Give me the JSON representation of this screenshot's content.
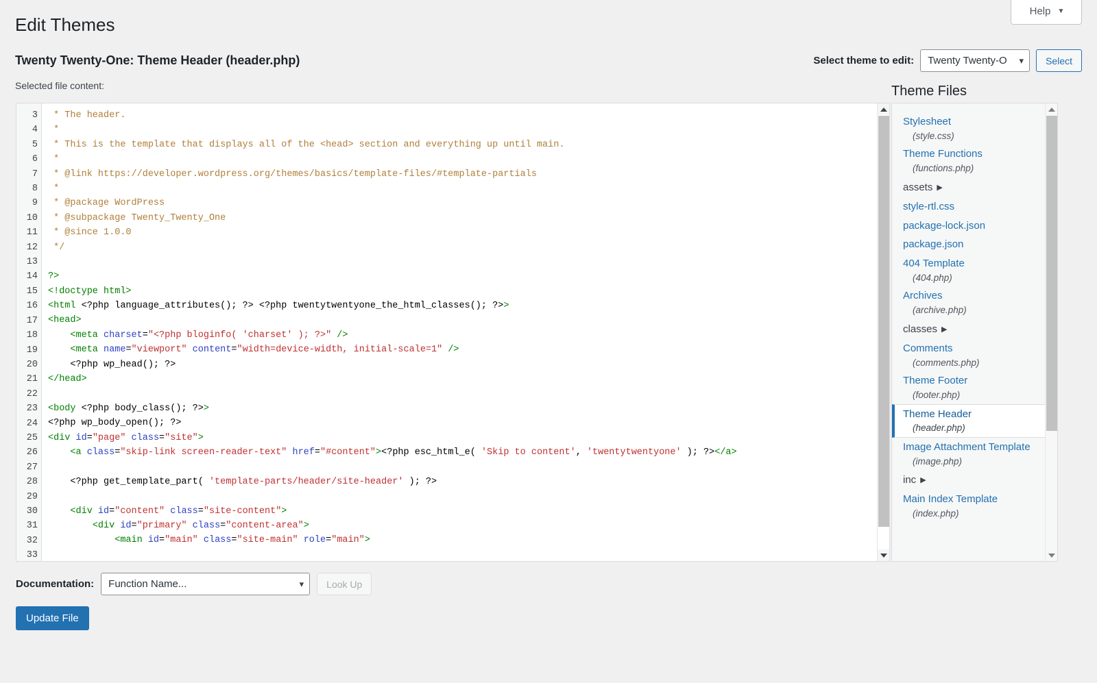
{
  "header": {
    "help_label": "Help",
    "help_caret": "▼",
    "page_title": "Edit Themes",
    "file_heading": "Twenty Twenty-One: Theme Header (header.php)",
    "selected_file_label": "Selected file content:",
    "theme_select_label": "Select theme to edit:",
    "theme_select_value": "Twenty Twenty-O",
    "theme_select_caret": "⌄",
    "select_button": "Select"
  },
  "editor": {
    "first_line_number": 3,
    "lines": [
      {
        "n": 3,
        "tokens": [
          {
            "t": "comment",
            "v": " * The header."
          }
        ]
      },
      {
        "n": 4,
        "tokens": [
          {
            "t": "comment",
            "v": " *"
          }
        ]
      },
      {
        "n": 5,
        "tokens": [
          {
            "t": "comment",
            "v": " * This is the template that displays all of the <head> section and everything up until main."
          }
        ]
      },
      {
        "n": 6,
        "tokens": [
          {
            "t": "comment",
            "v": " *"
          }
        ]
      },
      {
        "n": 7,
        "tokens": [
          {
            "t": "comment",
            "v": " * @link https://developer.wordpress.org/themes/basics/template-files/#template-partials"
          }
        ]
      },
      {
        "n": 8,
        "tokens": [
          {
            "t": "comment",
            "v": " *"
          }
        ]
      },
      {
        "n": 9,
        "tokens": [
          {
            "t": "comment",
            "v": " * @package WordPress"
          }
        ]
      },
      {
        "n": 10,
        "tokens": [
          {
            "t": "comment",
            "v": " * @subpackage Twenty_Twenty_One"
          }
        ]
      },
      {
        "n": 11,
        "tokens": [
          {
            "t": "comment",
            "v": " * @since 1.0.0"
          }
        ]
      },
      {
        "n": 12,
        "tokens": [
          {
            "t": "comment",
            "v": " */"
          }
        ]
      },
      {
        "n": 13,
        "tokens": [
          {
            "t": "plain",
            "v": ""
          }
        ]
      },
      {
        "n": 14,
        "tokens": [
          {
            "t": "tag",
            "v": "?>"
          }
        ]
      },
      {
        "n": 15,
        "tokens": [
          {
            "t": "tag",
            "v": "<!doctype html>"
          }
        ]
      },
      {
        "n": 16,
        "tokens": [
          {
            "t": "tag",
            "v": "<html"
          },
          {
            "t": "plain",
            "v": " <?php language_attributes(); ?> <?php twentytwentyone_the_html_classes(); ?>"
          },
          {
            "t": "tag",
            "v": ">"
          }
        ]
      },
      {
        "n": 17,
        "tokens": [
          {
            "t": "tag",
            "v": "<head>"
          }
        ]
      },
      {
        "n": 18,
        "tokens": [
          {
            "t": "plain",
            "v": "    "
          },
          {
            "t": "tag",
            "v": "<meta"
          },
          {
            "t": "attr",
            "v": " charset"
          },
          {
            "t": "plain",
            "v": "="
          },
          {
            "t": "str",
            "v": "\"<?php bloginfo( 'charset' ); ?>\""
          },
          {
            "t": "tag",
            "v": " />"
          }
        ]
      },
      {
        "n": 19,
        "tokens": [
          {
            "t": "plain",
            "v": "    "
          },
          {
            "t": "tag",
            "v": "<meta"
          },
          {
            "t": "attr",
            "v": " name"
          },
          {
            "t": "plain",
            "v": "="
          },
          {
            "t": "str",
            "v": "\"viewport\""
          },
          {
            "t": "attr",
            "v": " content"
          },
          {
            "t": "plain",
            "v": "="
          },
          {
            "t": "str",
            "v": "\"width=device-width, initial-scale=1\""
          },
          {
            "t": "tag",
            "v": " />"
          }
        ]
      },
      {
        "n": 20,
        "tokens": [
          {
            "t": "plain",
            "v": "    <?php wp_head(); ?>"
          }
        ]
      },
      {
        "n": 21,
        "tokens": [
          {
            "t": "tag",
            "v": "</head>"
          }
        ]
      },
      {
        "n": 22,
        "tokens": [
          {
            "t": "plain",
            "v": ""
          }
        ]
      },
      {
        "n": 23,
        "tokens": [
          {
            "t": "tag",
            "v": "<body"
          },
          {
            "t": "plain",
            "v": " <?php body_class(); ?>"
          },
          {
            "t": "tag",
            "v": ">"
          }
        ]
      },
      {
        "n": 24,
        "tokens": [
          {
            "t": "plain",
            "v": "<?php wp_body_open(); ?>"
          }
        ]
      },
      {
        "n": 25,
        "tokens": [
          {
            "t": "tag",
            "v": "<div"
          },
          {
            "t": "attr",
            "v": " id"
          },
          {
            "t": "plain",
            "v": "="
          },
          {
            "t": "str",
            "v": "\"page\""
          },
          {
            "t": "attr",
            "v": " class"
          },
          {
            "t": "plain",
            "v": "="
          },
          {
            "t": "str",
            "v": "\"site\""
          },
          {
            "t": "tag",
            "v": ">"
          }
        ]
      },
      {
        "n": 26,
        "tokens": [
          {
            "t": "plain",
            "v": "    "
          },
          {
            "t": "tag",
            "v": "<a"
          },
          {
            "t": "attr",
            "v": " class"
          },
          {
            "t": "plain",
            "v": "="
          },
          {
            "t": "str",
            "v": "\"skip-link screen-reader-text\""
          },
          {
            "t": "attr",
            "v": " href"
          },
          {
            "t": "plain",
            "v": "="
          },
          {
            "t": "str",
            "v": "\"#content\""
          },
          {
            "t": "tag",
            "v": ">"
          },
          {
            "t": "plain",
            "v": "<?php esc_html_e( "
          },
          {
            "t": "str",
            "v": "'Skip to content'"
          },
          {
            "t": "plain",
            "v": ", "
          },
          {
            "t": "str",
            "v": "'twentytwentyone'"
          },
          {
            "t": "plain",
            "v": " ); ?>"
          },
          {
            "t": "tag",
            "v": "</a>"
          }
        ]
      },
      {
        "n": 27,
        "tokens": [
          {
            "t": "plain",
            "v": ""
          }
        ]
      },
      {
        "n": 28,
        "tokens": [
          {
            "t": "plain",
            "v": "    <?php get_template_part( "
          },
          {
            "t": "str",
            "v": "'template-parts/header/site-header'"
          },
          {
            "t": "plain",
            "v": " ); ?>"
          }
        ]
      },
      {
        "n": 29,
        "tokens": [
          {
            "t": "plain",
            "v": ""
          }
        ]
      },
      {
        "n": 30,
        "tokens": [
          {
            "t": "plain",
            "v": "    "
          },
          {
            "t": "tag",
            "v": "<div"
          },
          {
            "t": "attr",
            "v": " id"
          },
          {
            "t": "plain",
            "v": "="
          },
          {
            "t": "str",
            "v": "\"content\""
          },
          {
            "t": "attr",
            "v": " class"
          },
          {
            "t": "plain",
            "v": "="
          },
          {
            "t": "str",
            "v": "\"site-content\""
          },
          {
            "t": "tag",
            "v": ">"
          }
        ]
      },
      {
        "n": 31,
        "tokens": [
          {
            "t": "plain",
            "v": "        "
          },
          {
            "t": "tag",
            "v": "<div"
          },
          {
            "t": "attr",
            "v": " id"
          },
          {
            "t": "plain",
            "v": "="
          },
          {
            "t": "str",
            "v": "\"primary\""
          },
          {
            "t": "attr",
            "v": " class"
          },
          {
            "t": "plain",
            "v": "="
          },
          {
            "t": "str",
            "v": "\"content-area\""
          },
          {
            "t": "tag",
            "v": ">"
          }
        ]
      },
      {
        "n": 32,
        "tokens": [
          {
            "t": "plain",
            "v": "            "
          },
          {
            "t": "tag",
            "v": "<main"
          },
          {
            "t": "attr",
            "v": " id"
          },
          {
            "t": "plain",
            "v": "="
          },
          {
            "t": "str",
            "v": "\"main\""
          },
          {
            "t": "attr",
            "v": " class"
          },
          {
            "t": "plain",
            "v": "="
          },
          {
            "t": "str",
            "v": "\"site-main\""
          },
          {
            "t": "attr",
            "v": " role"
          },
          {
            "t": "plain",
            "v": "="
          },
          {
            "t": "str",
            "v": "\"main\""
          },
          {
            "t": "tag",
            "v": ">"
          }
        ]
      },
      {
        "n": 33,
        "tokens": [
          {
            "t": "plain",
            "v": ""
          }
        ]
      }
    ]
  },
  "theme_files": {
    "heading": "Theme Files",
    "items": [
      {
        "name": "Stylesheet",
        "path": "(style.css)",
        "type": "file"
      },
      {
        "name": "Theme Functions",
        "path": "(functions.php)",
        "type": "file"
      },
      {
        "name": "assets",
        "path": "",
        "type": "folder",
        "caret": "▶"
      },
      {
        "name": "style-rtl.css",
        "path": "",
        "type": "file"
      },
      {
        "name": "package-lock.json",
        "path": "",
        "type": "file"
      },
      {
        "name": "package.json",
        "path": "",
        "type": "file"
      },
      {
        "name": "404 Template",
        "path": "(404.php)",
        "type": "file"
      },
      {
        "name": "Archives",
        "path": "(archive.php)",
        "type": "file"
      },
      {
        "name": "classes",
        "path": "",
        "type": "folder",
        "caret": "▶"
      },
      {
        "name": "Comments",
        "path": "(comments.php)",
        "type": "file"
      },
      {
        "name": "Theme Footer",
        "path": "(footer.php)",
        "type": "file"
      },
      {
        "name": "Theme Header",
        "path": "(header.php)",
        "type": "file",
        "active": true
      },
      {
        "name": "Image Attachment Template",
        "path": "(image.php)",
        "type": "file"
      },
      {
        "name": "inc",
        "path": "",
        "type": "folder",
        "caret": "▶"
      },
      {
        "name": "Main Index Template",
        "path": "(index.php)",
        "type": "file"
      }
    ]
  },
  "footer": {
    "documentation_label": "Documentation:",
    "documentation_value": "Function Name...",
    "lookup_button": "Look Up",
    "update_button": "Update File"
  },
  "colors": {
    "accent": "#2271b1",
    "page_bg": "#f0f0f1",
    "comment": "#b07f3a",
    "tag": "#008000",
    "attr": "#2b41c4",
    "string": "#c03030"
  }
}
